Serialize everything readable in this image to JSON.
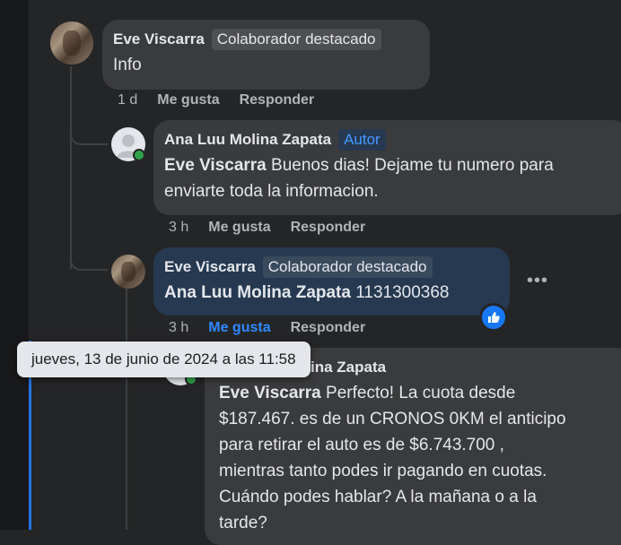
{
  "comments": [
    {
      "author": "Eve Viscarra",
      "badge": "Colaborador destacado",
      "text": "Info",
      "time": "1 d",
      "like_label": "Me gusta",
      "reply_label": "Responder"
    },
    {
      "author": "Ana Luu Molina Zapata",
      "badge": "Autor",
      "mention": "Eve Viscarra",
      "text_line1": " Buenos dias! Dejame tu numero para",
      "text_line2": "enviarte toda la informacion.",
      "time": "3 h",
      "like_label": "Me gusta",
      "reply_label": "Responder"
    },
    {
      "author": "Eve Viscarra",
      "badge": "Colaborador destacado",
      "mention": "Ana Luu Molina Zapata",
      "text": " 1131300368",
      "time": "3 h",
      "like_label": "Me gusta",
      "reply_label": "Responder",
      "liked": true
    },
    {
      "author": "Ana Luu Molina Zapata",
      "mention": "Eve Viscarra",
      "text_line1": " Perfecto! La cuota desde",
      "text_line2": "$187.467. es de un CRONOS 0KM el anticipo",
      "text_line3": "para retirar el auto es de $6.743.700 ,",
      "text_line4": "mientras tanto podes ir pagando en cuotas.",
      "text_line5": "Cuándo podes hablar? A la mañana o a la",
      "text_line6": "tarde?"
    }
  ],
  "tooltip": "jueves, 13 de junio de 2024 a las 11:58",
  "more_button": "•••",
  "icons": {
    "like_reaction": "thumbs-up-icon",
    "more": "more-options-icon"
  },
  "colors": {
    "background": "#242526",
    "bubble": "#3a3b3c",
    "highlight_bubble": "#263951",
    "accent": "#2e89ff"
  }
}
